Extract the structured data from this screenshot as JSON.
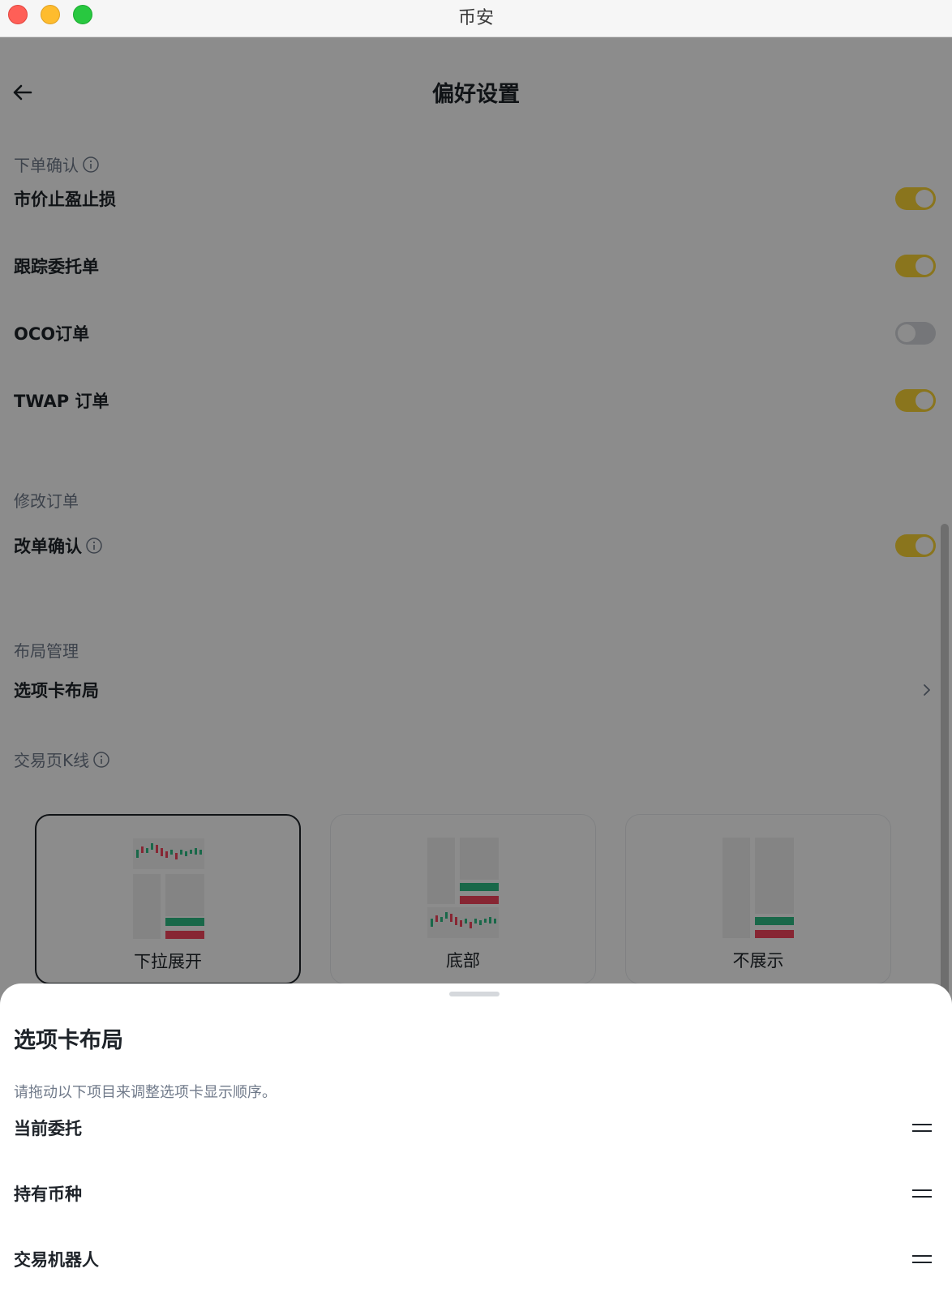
{
  "window": {
    "title": "币安"
  },
  "header": {
    "title": "偏好设置"
  },
  "order_confirm": {
    "section_title": "下单确认",
    "items": [
      {
        "label": "市价止盈止损",
        "enabled": true
      },
      {
        "label": "跟踪委托单",
        "enabled": true
      },
      {
        "label": "OCO订单",
        "enabled": false
      },
      {
        "label": "TWAP 订单",
        "enabled": true
      }
    ]
  },
  "modify_order": {
    "section_title": "修改订单",
    "item": {
      "label": "改单确认",
      "enabled": true
    }
  },
  "layout": {
    "section_title": "布局管理",
    "item_label": "选项卡布局"
  },
  "kline": {
    "section_title": "交易页K线",
    "options": [
      {
        "label": "下拉展开",
        "selected": true
      },
      {
        "label": "底部",
        "selected": false
      },
      {
        "label": "不展示",
        "selected": false
      }
    ]
  },
  "sheet": {
    "title": "选项卡布局",
    "description": "请拖动以下项目来调整选项卡显示顺序。",
    "items": [
      {
        "label": "当前委托"
      },
      {
        "label": "持有币种"
      },
      {
        "label": "交易机器人"
      }
    ]
  },
  "colors": {
    "toggle_on": "#fcd535",
    "toggle_off": "#d5d8dc",
    "candle_green": "#2ebd85",
    "candle_red": "#f6465d"
  }
}
